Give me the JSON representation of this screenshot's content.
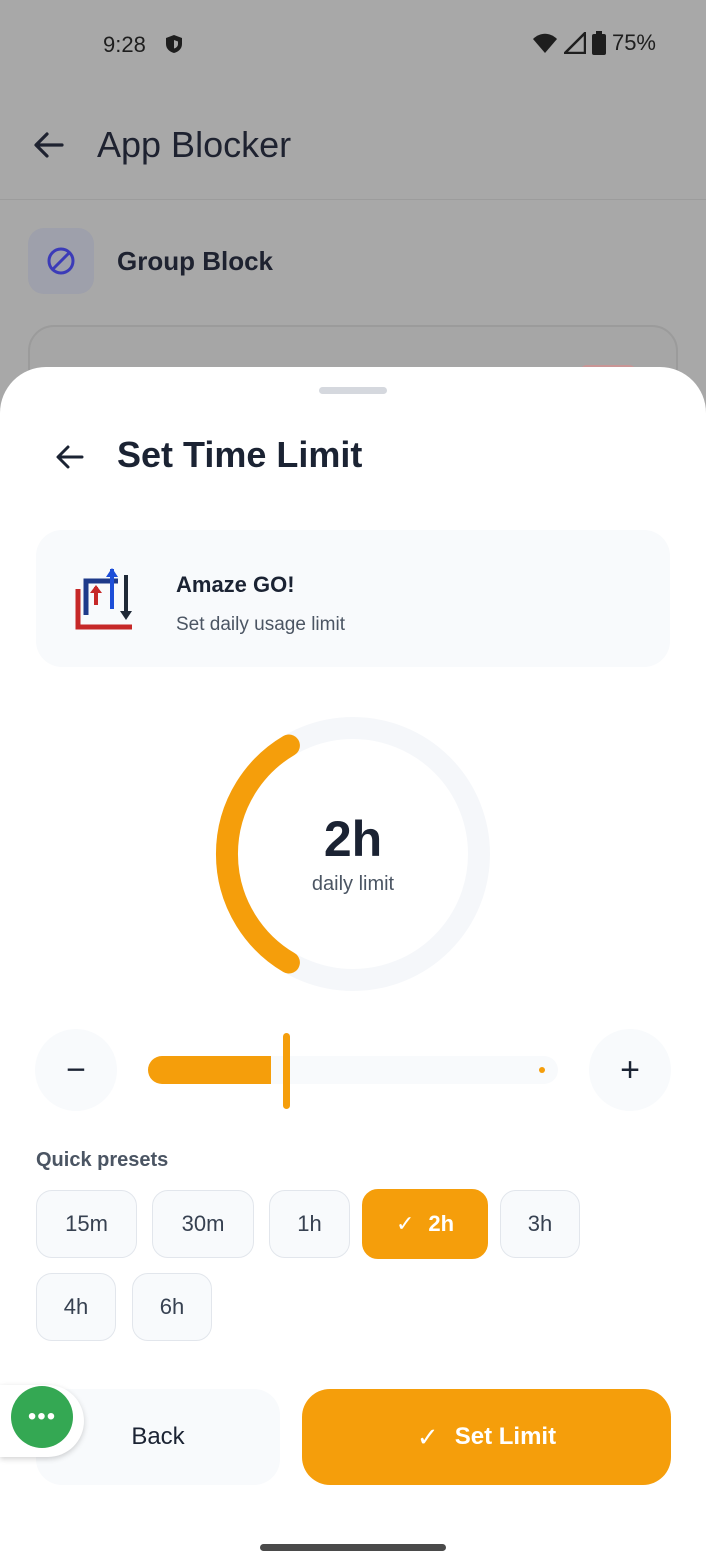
{
  "status_bar": {
    "time": "9:28",
    "battery": "75%"
  },
  "background_app": {
    "title": "App Blocker",
    "group_label": "Group Block"
  },
  "sheet": {
    "title": "Set Time Limit",
    "app_name": "Amaze GO!",
    "app_subtitle": "Set daily usage limit",
    "dial_value": "2h",
    "dial_label": "daily limit",
    "dial_progress": 0.33,
    "slider_fraction": 0.33,
    "minus_label": "−",
    "plus_label": "+",
    "presets_label": "Quick presets",
    "presets": [
      "15m",
      "30m",
      "1h",
      "2h",
      "3h",
      "4h",
      "6h"
    ],
    "selected_preset": "2h",
    "back_label": "Back",
    "set_limit_label": "Set Limit"
  },
  "fab": {
    "label": "•••"
  },
  "colors": {
    "accent": "#f59e0b",
    "fab": "#34a853",
    "text": "#1b2333"
  },
  "icons": [
    "shield-icon",
    "wifi-icon",
    "signal-icon",
    "battery-icon",
    "back-arrow-icon",
    "block-icon",
    "app-logo-icon",
    "check-icon",
    "more-icon"
  ]
}
